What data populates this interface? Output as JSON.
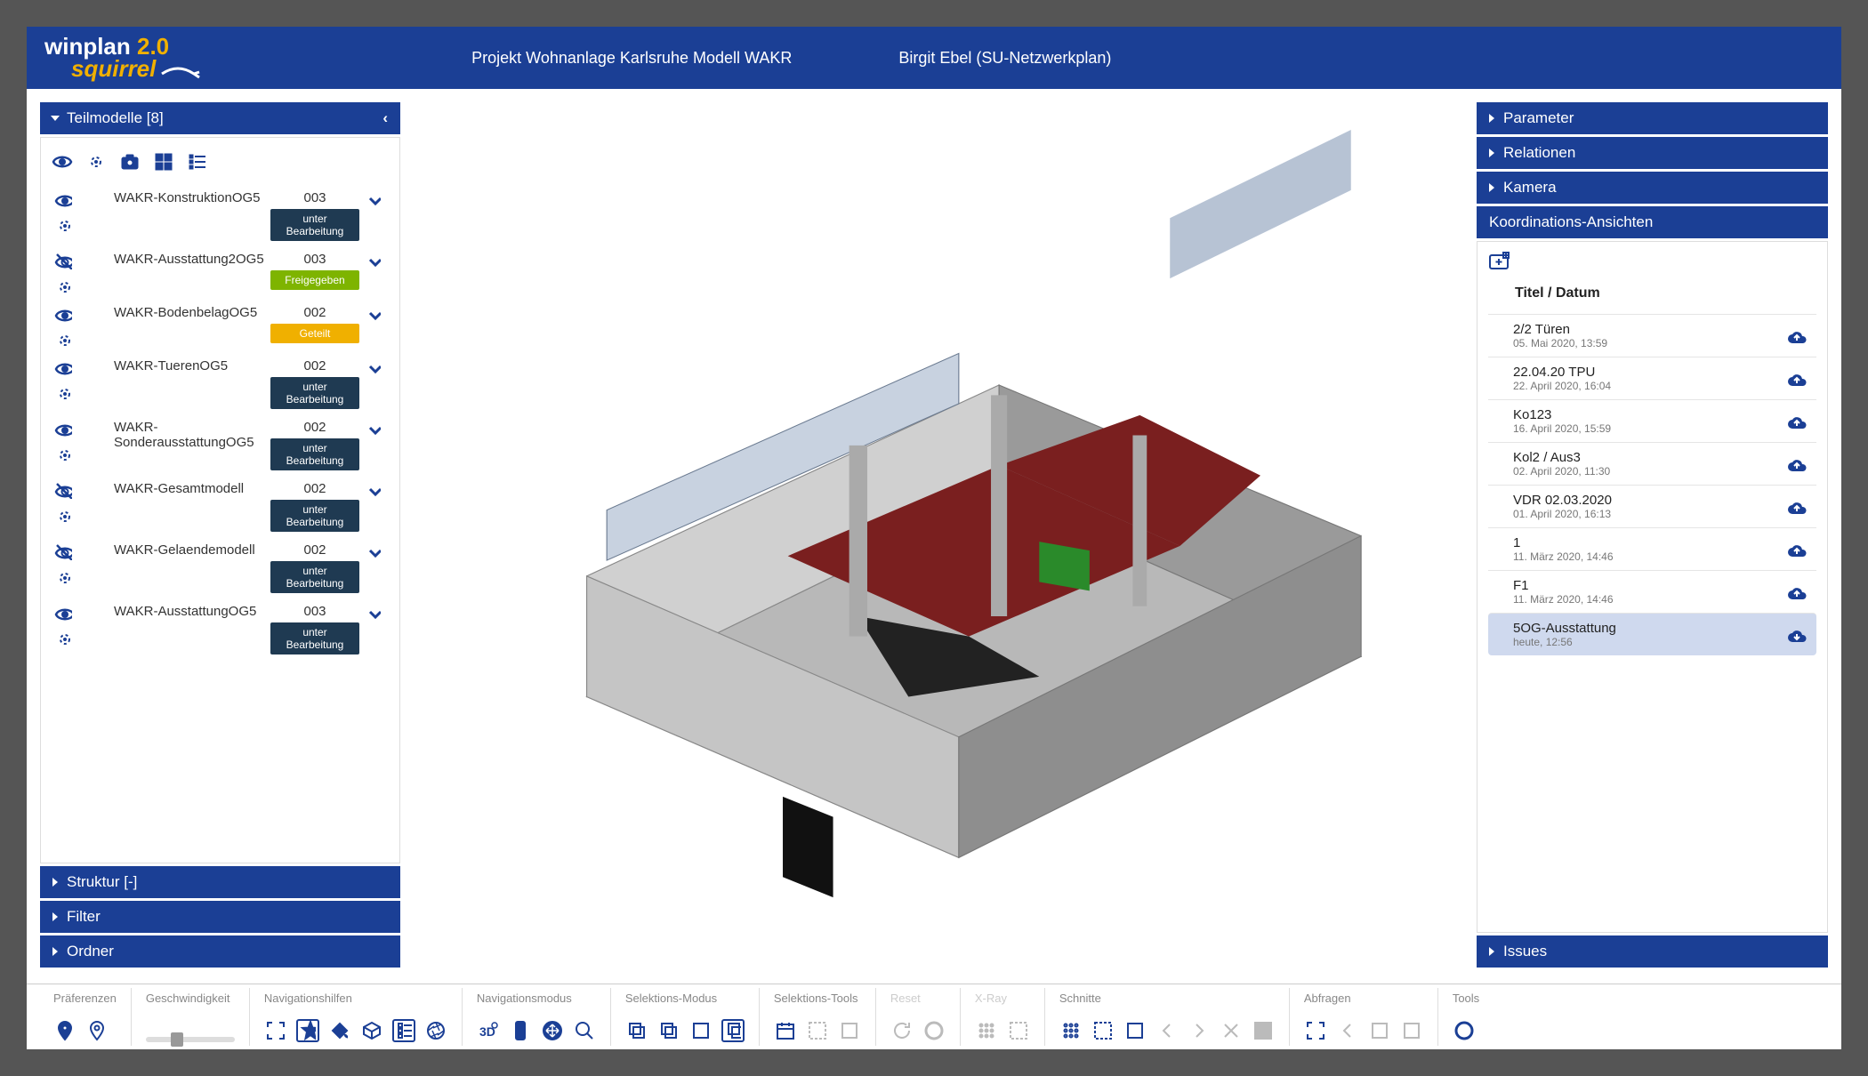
{
  "header": {
    "logo_line1_a": "winplan ",
    "logo_line1_b": "2.0",
    "logo_line2": "squirrel",
    "project": "Projekt Wohnanlage Karlsruhe Modell WAKR",
    "user": "Birgit Ebel (SU-Netzwerkplan)"
  },
  "left": {
    "teilmodelle_label": "Teilmodelle [8]",
    "struktur_label": "Struktur [-]",
    "filter_label": "Filter",
    "ordner_label": "Ordner",
    "status_labels": {
      "bearb": "unter Bearbeitung",
      "frei": "Freigegeben",
      "geteilt": "Geteilt"
    },
    "models": [
      {
        "name": "WAKR-KonstruktionOG5",
        "num": "003",
        "status": "bearb",
        "vis": true
      },
      {
        "name": "WAKR-Ausstattung2OG5",
        "num": "003",
        "status": "frei",
        "vis": false
      },
      {
        "name": "WAKR-BodenbelagOG5",
        "num": "002",
        "status": "geteilt",
        "vis": true
      },
      {
        "name": "WAKR-TuerenOG5",
        "num": "002",
        "status": "bearb",
        "vis": true
      },
      {
        "name": "WAKR-SonderausstattungOG5",
        "num": "002",
        "status": "bearb",
        "vis": true
      },
      {
        "name": "WAKR-Gesamtmodell",
        "num": "002",
        "status": "bearb",
        "vis": false
      },
      {
        "name": "WAKR-Gelaendemodell",
        "num": "002",
        "status": "bearb",
        "vis": false
      },
      {
        "name": "WAKR-AusstattungOG5",
        "num": "003",
        "status": "bearb",
        "vis": true
      }
    ]
  },
  "right": {
    "parameter_label": "Parameter",
    "relationen_label": "Relationen",
    "kamera_label": "Kamera",
    "koord_label": "Koordinations-Ansichten",
    "issues_label": "Issues",
    "col_header": "Titel / Datum",
    "views": [
      {
        "title": "2/2 Türen",
        "date": "05. Mai 2020, 13:59",
        "sel": false
      },
      {
        "title": "22.04.20 TPU",
        "date": "22. April 2020, 16:04",
        "sel": false
      },
      {
        "title": "Ko123",
        "date": "16. April 2020, 15:59",
        "sel": false
      },
      {
        "title": "Kol2 / Aus3",
        "date": "02. April 2020, 11:30",
        "sel": false
      },
      {
        "title": "VDR 02.03.2020",
        "date": "01. April 2020, 16:13",
        "sel": false
      },
      {
        "title": "1",
        "date": "11. März 2020, 14:46",
        "sel": false
      },
      {
        "title": "F1",
        "date": "11. März 2020, 14:46",
        "sel": false
      },
      {
        "title": "5OG-Ausstattung",
        "date": "heute, 12:56",
        "sel": true
      }
    ]
  },
  "toolbar": {
    "praeferenzen": "Präferenzen",
    "geschwindigkeit": "Geschwindigkeit",
    "navhilfen": "Navigationshilfen",
    "navmodus": "Navigationsmodus",
    "selmodus": "Selektions-Modus",
    "seltools": "Selektions-Tools",
    "reset": "Reset",
    "xray": "X-Ray",
    "schnitte": "Schnitte",
    "abfragen": "Abfragen",
    "tools": "Tools"
  }
}
